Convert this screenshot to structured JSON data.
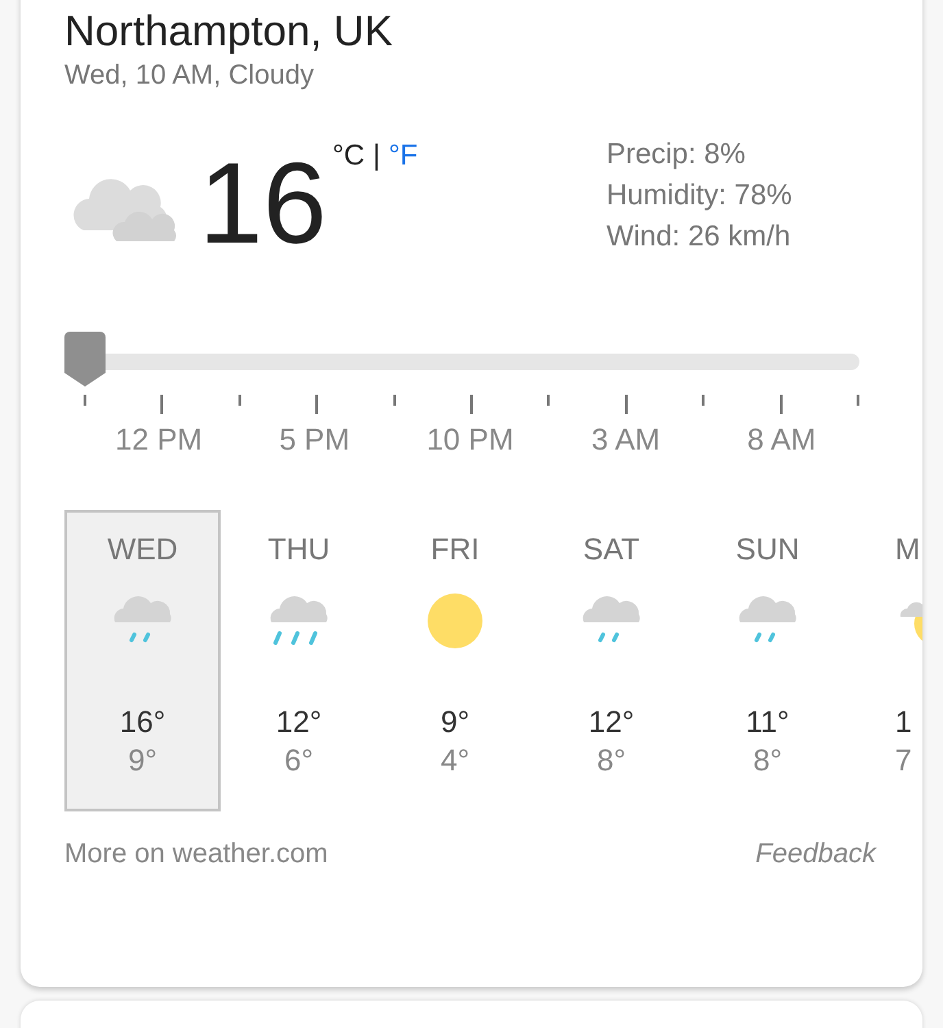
{
  "location": "Northampton, UK",
  "subtitle": "Wed, 10 AM, Cloudy",
  "current": {
    "kind": "cloudy",
    "temperature": "16",
    "units": [
      {
        "label": "°C",
        "selected": true
      },
      {
        "label": "°F",
        "selected": false
      }
    ],
    "unit_separator": "|"
  },
  "details": [
    "Precip: 8%",
    "Humidity: 78%",
    "Wind: 26 km/h"
  ],
  "timeline": {
    "level": 0,
    "labels": [
      "12 PM",
      "5 PM",
      "10 PM",
      "3 AM",
      "8 AM"
    ]
  },
  "days": [
    {
      "label": "WED",
      "kind": "rain",
      "high": "16°",
      "low": "9°",
      "selected": true
    },
    {
      "label": "THU",
      "kind": "heavy_rain",
      "high": "12°",
      "low": "6°",
      "selected": false
    },
    {
      "label": "FRI",
      "kind": "sun",
      "high": "9°",
      "low": "4°",
      "selected": false
    },
    {
      "label": "SAT",
      "kind": "rain",
      "high": "12°",
      "low": "8°",
      "selected": false
    },
    {
      "label": "SUN",
      "kind": "rain",
      "high": "11°",
      "low": "8°",
      "selected": false
    },
    {
      "label": "M",
      "kind": "partly_sunny",
      "high": "1",
      "low": "7",
      "selected": false
    }
  ],
  "footer": {
    "source_link": "More on weather.com",
    "feedback": "Feedback"
  }
}
